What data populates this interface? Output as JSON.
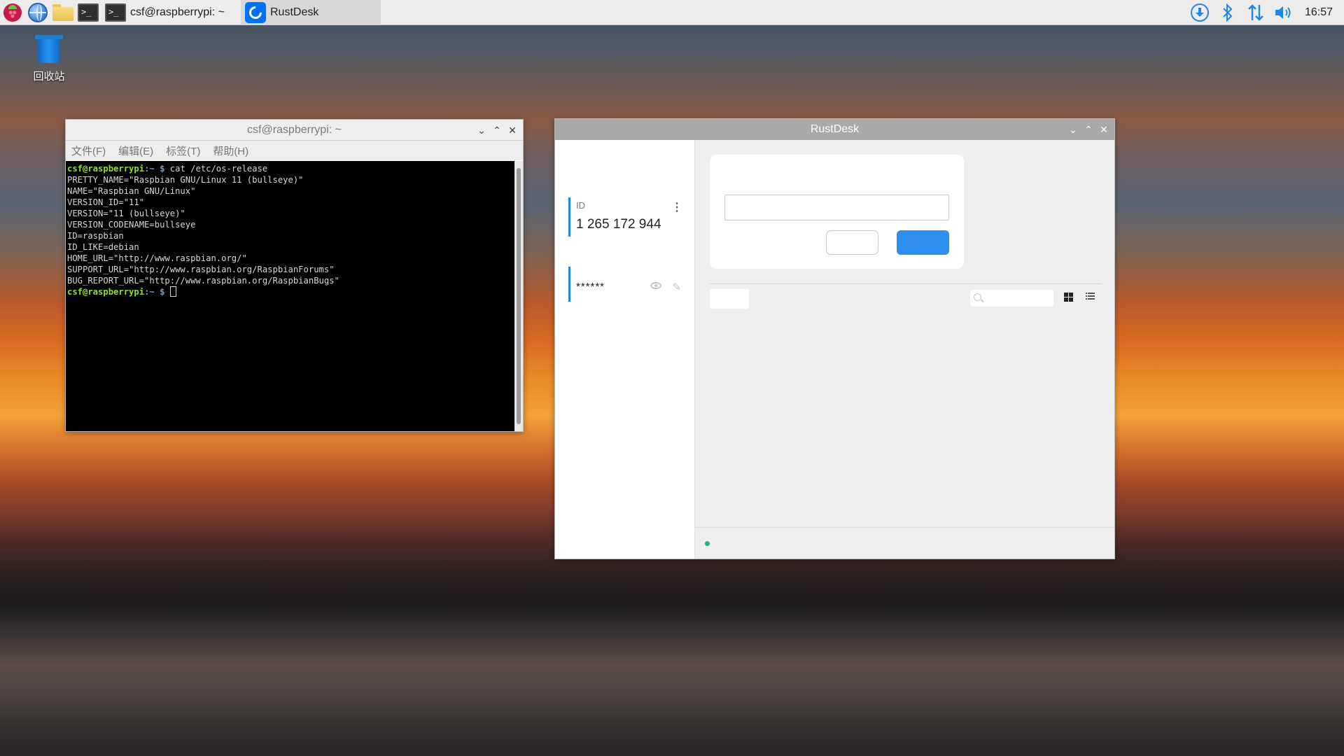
{
  "taskbar": {
    "launchers": [
      {
        "name": "raspberry-menu-icon"
      },
      {
        "name": "browser-globe-icon"
      },
      {
        "name": "file-manager-folder-icon"
      },
      {
        "name": "terminal-launcher-icon"
      }
    ],
    "tasks": [
      {
        "label": "csf@raspberrypi: ~",
        "icon": "terminal-icon",
        "active": false
      },
      {
        "label": "RustDesk",
        "icon": "rustdesk-icon",
        "active": true
      }
    ],
    "tray": {
      "icons": [
        "download-icon",
        "bluetooth-icon",
        "network-transfer-icon",
        "volume-icon"
      ],
      "clock": "16:57"
    }
  },
  "desktop": {
    "trash_label": "回收站"
  },
  "terminal": {
    "title": "csf@raspberrypi: ~",
    "menu": [
      "文件(F)",
      "编辑(E)",
      "标签(T)",
      "帮助(H)"
    ],
    "prompt_user": "csf@raspberrypi",
    "prompt_path": ":~ $",
    "command": "cat /etc/os-release",
    "output": [
      "PRETTY_NAME=\"Raspbian GNU/Linux 11 (bullseye)\"",
      "NAME=\"Raspbian GNU/Linux\"",
      "VERSION_ID=\"11\"",
      "VERSION=\"11 (bullseye)\"",
      "VERSION_CODENAME=bullseye",
      "ID=raspbian",
      "ID_LIKE=debian",
      "HOME_URL=\"http://www.raspbian.org/\"",
      "SUPPORT_URL=\"http://www.raspbian.org/RaspbianForums\"",
      "BUG_REPORT_URL=\"http://www.raspbian.org/RaspbianBugs\""
    ]
  },
  "rustdesk": {
    "title": "RustDesk",
    "id_label": "ID",
    "id_value": "1 265 172 944",
    "password_value": "******",
    "menu_glyph": "⋮",
    "edit_glyph": "✎",
    "status_color": "#20b58a",
    "accent_color": "#2f8ff0"
  },
  "window_controls": {
    "minimize": "⌄",
    "maximize": "⌃",
    "close": "✕"
  }
}
